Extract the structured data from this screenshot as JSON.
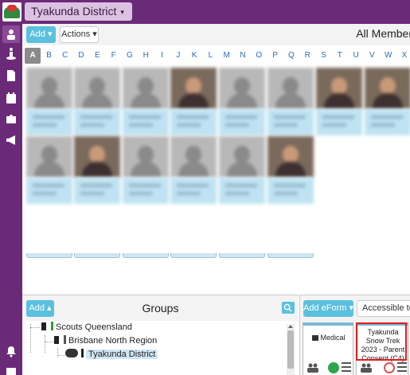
{
  "header": {
    "district_label": "Tyakunda District",
    "district_caret": "▾"
  },
  "sidebar": {
    "items": [
      {
        "name": "members",
        "icon": "members-icon"
      },
      {
        "name": "activities",
        "icon": "hiker-icon"
      },
      {
        "name": "documents",
        "icon": "document-icon"
      },
      {
        "name": "calendar",
        "icon": "calendar-check-icon"
      },
      {
        "name": "addons",
        "icon": "puzzle-icon"
      },
      {
        "name": "announcements",
        "icon": "megaphone-icon"
      },
      {
        "name": "notifications",
        "icon": "bell-icon"
      },
      {
        "name": "inbox",
        "icon": "tray-icon"
      }
    ]
  },
  "toolbar": {
    "add_label": "Add ▾",
    "actions_label": "Actions ▾",
    "title": "All Members"
  },
  "alphabet": {
    "letters": [
      "A",
      "B",
      "C",
      "D",
      "E",
      "F",
      "G",
      "H",
      "I",
      "J",
      "K",
      "L",
      "M",
      "N",
      "O",
      "P",
      "Q",
      "R",
      "S",
      "T",
      "U",
      "V",
      "W",
      "X"
    ],
    "selected": "A"
  },
  "groups": {
    "add_label": "Add ▴",
    "title": "Groups",
    "tree": [
      {
        "label": "Scouts Queensland",
        "color": "#2e9c3a"
      },
      {
        "label": "Brisbane North Region",
        "color": "#555555"
      },
      {
        "label": "Tyakunda District",
        "color": "#222222"
      }
    ]
  },
  "eforms": {
    "add_label": "Add eForm ▾",
    "filter_label": "Accessible to m",
    "cards": [
      {
        "title": "Medical",
        "status": "check"
      },
      {
        "title": "Tyakunda Snow Trek 2023 - Parent Consent (C4)",
        "status": "clock"
      }
    ]
  }
}
